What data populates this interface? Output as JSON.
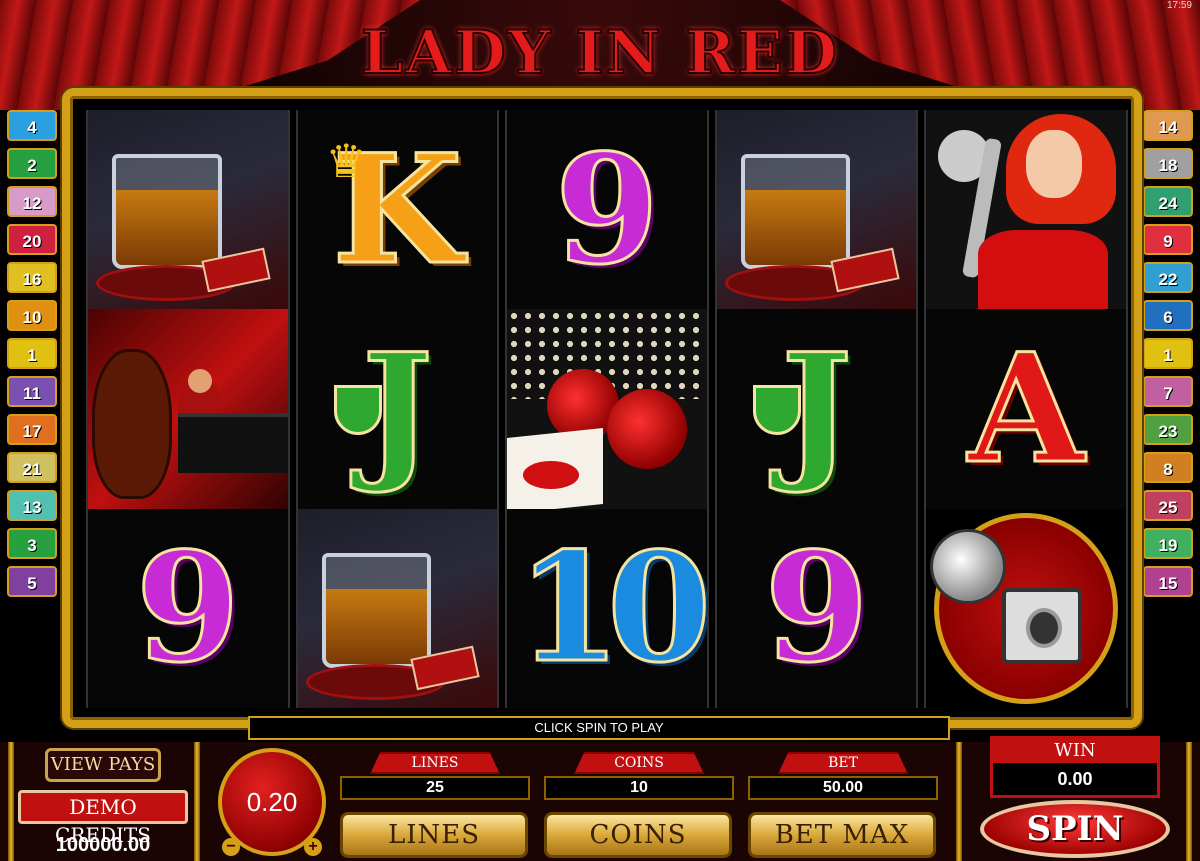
{
  "title": "LADY IN RED",
  "clock": "17:59",
  "status_text": "CLICK SPIN TO PLAY",
  "left_markers": [
    {
      "n": "4",
      "color": "#2aa0e0"
    },
    {
      "n": "2",
      "color": "#24a040"
    },
    {
      "n": "12",
      "color": "#d89ac8"
    },
    {
      "n": "20",
      "color": "#d02040"
    },
    {
      "n": "16",
      "color": "#e0c020"
    },
    {
      "n": "10",
      "color": "#e09010"
    },
    {
      "n": "1",
      "color": "#e0c010"
    },
    {
      "n": "11",
      "color": "#7a50b0"
    },
    {
      "n": "17",
      "color": "#e07020"
    },
    {
      "n": "21",
      "color": "#d0c060"
    },
    {
      "n": "13",
      "color": "#50c0b0"
    },
    {
      "n": "3",
      "color": "#28a040"
    },
    {
      "n": "5",
      "color": "#8040a0"
    }
  ],
  "right_markers": [
    {
      "n": "14",
      "color": "#e09a50"
    },
    {
      "n": "18",
      "color": "#a0a0a0"
    },
    {
      "n": "24",
      "color": "#30a070"
    },
    {
      "n": "9",
      "color": "#e03040"
    },
    {
      "n": "22",
      "color": "#30a0d0"
    },
    {
      "n": "6",
      "color": "#2070c0"
    },
    {
      "n": "1",
      "color": "#e0c010"
    },
    {
      "n": "7",
      "color": "#c060a0"
    },
    {
      "n": "23",
      "color": "#50a040"
    },
    {
      "n": "8",
      "color": "#d08020"
    },
    {
      "n": "25",
      "color": "#c04060"
    },
    {
      "n": "19",
      "color": "#40b060"
    },
    {
      "n": "15",
      "color": "#b04090"
    }
  ],
  "reels": [
    [
      "whisky",
      "band",
      "9"
    ],
    [
      "K",
      "J",
      "whisky"
    ],
    [
      "9",
      "roses",
      "10"
    ],
    [
      "whisky",
      "J",
      "9"
    ],
    [
      "singer",
      "A",
      "camera"
    ]
  ],
  "controls": {
    "view_pays": "VIEW PAYS",
    "demo_credits": "DEMO CREDITS",
    "credits_value": "100000.00",
    "coin_value": "0.20",
    "minus": "−",
    "plus": "+",
    "lines_label": "LINES",
    "lines_value": "25",
    "coins_label": "COINS",
    "coins_value": "10",
    "bet_label": "BET",
    "bet_value": "50.00",
    "lines_btn": "LINES",
    "coins_btn": "COINS",
    "betmax_btn": "BET MAX",
    "win_label": "WIN",
    "win_value": "0.00",
    "spin_btn": "SPIN"
  }
}
